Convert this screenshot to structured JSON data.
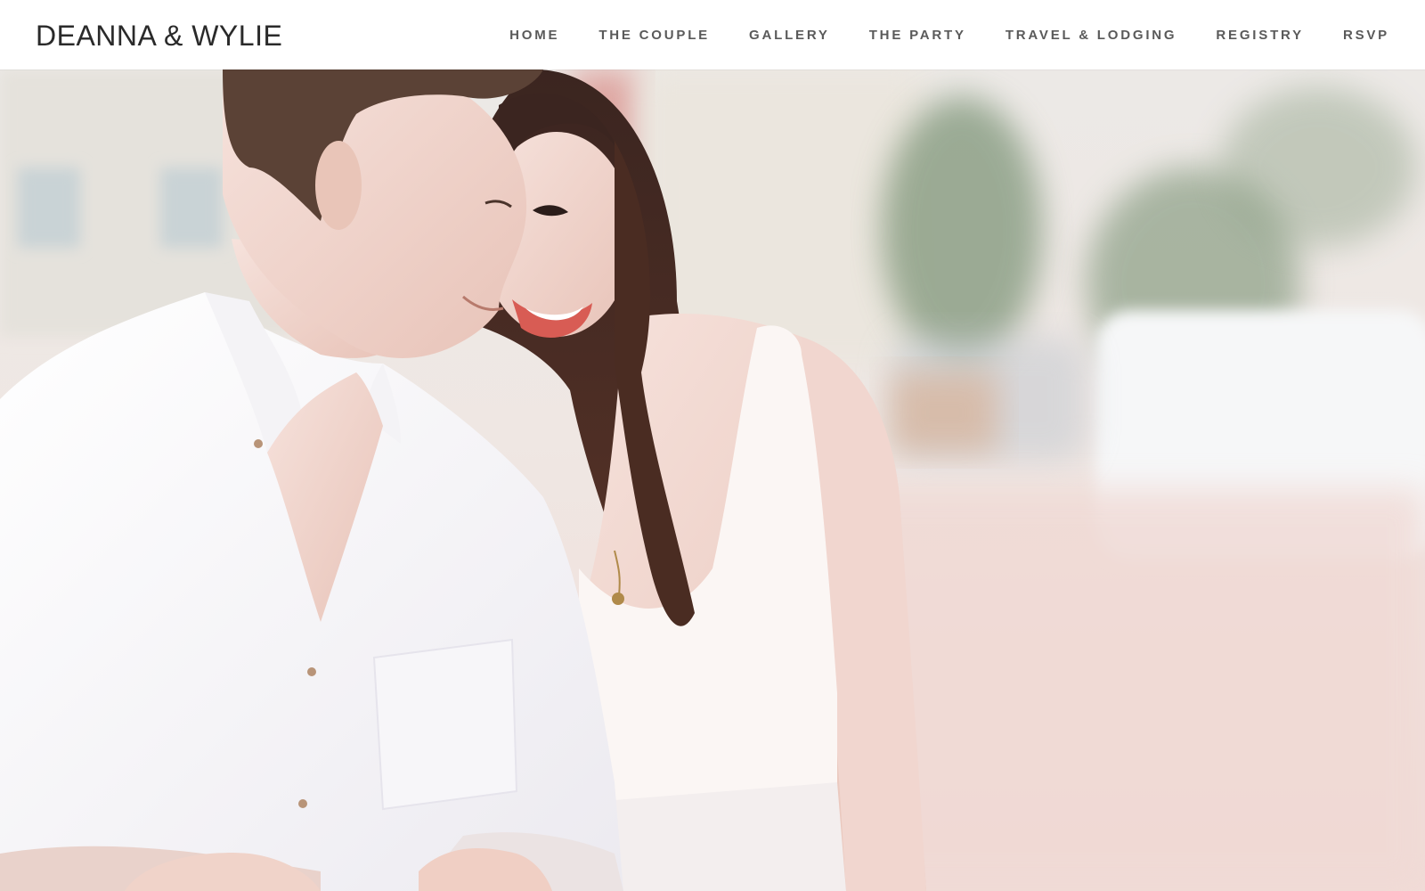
{
  "site": {
    "title": "DEANNA & WYLIE"
  },
  "nav": {
    "items": [
      {
        "label": "HOME",
        "name": "nav-home"
      },
      {
        "label": "THE COUPLE",
        "name": "nav-the-couple"
      },
      {
        "label": "GALLERY",
        "name": "nav-gallery"
      },
      {
        "label": "THE PARTY",
        "name": "nav-the-party"
      },
      {
        "label": "TRAVEL & LODGING",
        "name": "nav-travel-lodging"
      },
      {
        "label": "REGISTRY",
        "name": "nav-registry"
      },
      {
        "label": "RSVP",
        "name": "nav-rsvp"
      }
    ]
  },
  "colors": {
    "header_bg": "#ffffff",
    "title_text": "#2a2a2a",
    "nav_text": "#5a5a5a"
  }
}
